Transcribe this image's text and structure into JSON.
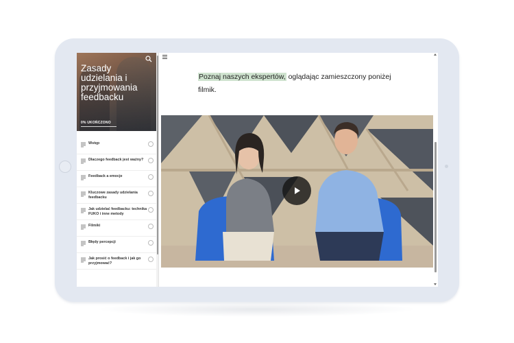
{
  "course": {
    "title": "Zasady udzielania i przyjmowania feedbacku",
    "progress_label": "0% UKOŃCZONO"
  },
  "sidebar": {
    "items": [
      {
        "label": "Wstęp"
      },
      {
        "label": "Dlaczego feedback jest ważny?"
      },
      {
        "label": "Feedback a emocje"
      },
      {
        "label": "Kluczowe zasady udzielania feedbacku"
      },
      {
        "label": "Jak udzielać feedbacku: technika FUKO i inne metody"
      },
      {
        "label": "Filmiki"
      },
      {
        "label": "Błędy percepcji"
      },
      {
        "label": "Jak prosić o feedback i jak go przyjmować?"
      }
    ]
  },
  "main": {
    "intro_highlight": "Poznaj naszych ekspertów,",
    "intro_rest": " oglądając zamieszczony poniżej filmik."
  },
  "icons": {
    "search": "search-icon",
    "menu": "hamburger-icon",
    "play": "play-icon",
    "lesson": "document-icon",
    "status": "circle-icon"
  },
  "colors": {
    "highlight": "#cfe3cf",
    "chair_blue": "#2f6fd3",
    "tablet_frame": "#e3e8f1"
  }
}
